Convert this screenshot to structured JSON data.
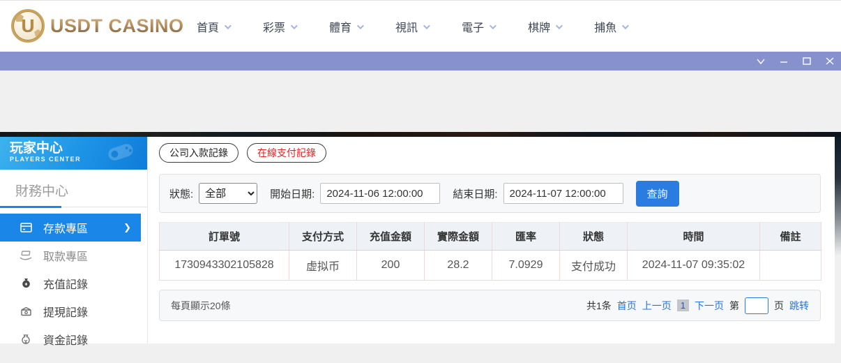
{
  "header": {
    "logo": {
      "monogram": "U",
      "brand": "USDT CASINO"
    },
    "nav": [
      {
        "label": "首頁"
      },
      {
        "label": "彩票"
      },
      {
        "label": "體育"
      },
      {
        "label": "視訊"
      },
      {
        "label": "電子"
      },
      {
        "label": "棋牌"
      },
      {
        "label": "捕魚"
      }
    ]
  },
  "titlebar": {
    "controls": [
      "chevron-down-icon",
      "minimize-icon",
      "maximize-icon",
      "close-icon"
    ]
  },
  "sidebar": {
    "banner": {
      "title": "玩家中心",
      "subtitle": "PLAYERS CENTER"
    },
    "section_title": "財務中心",
    "items": [
      {
        "label": "存款專區",
        "icon": "deposit-icon",
        "active": true
      },
      {
        "label": "取款專區",
        "icon": "withdraw-icon",
        "active": false
      },
      {
        "label": "充值記錄",
        "icon": "recharge-record-icon",
        "active": false
      },
      {
        "label": "提現記錄",
        "icon": "withdraw-record-icon",
        "active": false
      },
      {
        "label": "資金記錄",
        "icon": "funds-record-icon",
        "active": false
      }
    ]
  },
  "main": {
    "tabs": [
      {
        "label": "公司入款記錄",
        "active": false
      },
      {
        "label": "在線支付記錄",
        "active": true
      }
    ],
    "filters": {
      "status_label": "狀態:",
      "status_value": "全部",
      "start_label": "開始日期:",
      "start_value": "2024-11-06 12:00:00",
      "end_label": "結束日期:",
      "end_value": "2024-11-07 12:00:00",
      "search_button": "查詢"
    },
    "table": {
      "headers": [
        "訂單號",
        "支付方式",
        "充值金額",
        "實際金額",
        "匯率",
        "狀態",
        "時間",
        "備註"
      ],
      "rows": [
        [
          "1730943302105828",
          "虚拟币",
          "200",
          "28.2",
          "7.0929",
          "支付成功",
          "2024-11-07 09:35:02",
          ""
        ]
      ]
    },
    "pagination": {
      "page_size_text": "每頁顯示20條",
      "total_text": "共1条",
      "first": "首页",
      "prev": "上一页",
      "current": "1",
      "next": "下一页",
      "jump_prefix": "第",
      "jump_suffix": "页",
      "jump_button": "跳转"
    }
  },
  "colors": {
    "accent_blue": "#1a86e8",
    "titlebar_purple": "#8791ce",
    "tab_active_red": "#e02424",
    "brand_gold": "#a98350",
    "table_border_pink": "#f2d8d8"
  }
}
